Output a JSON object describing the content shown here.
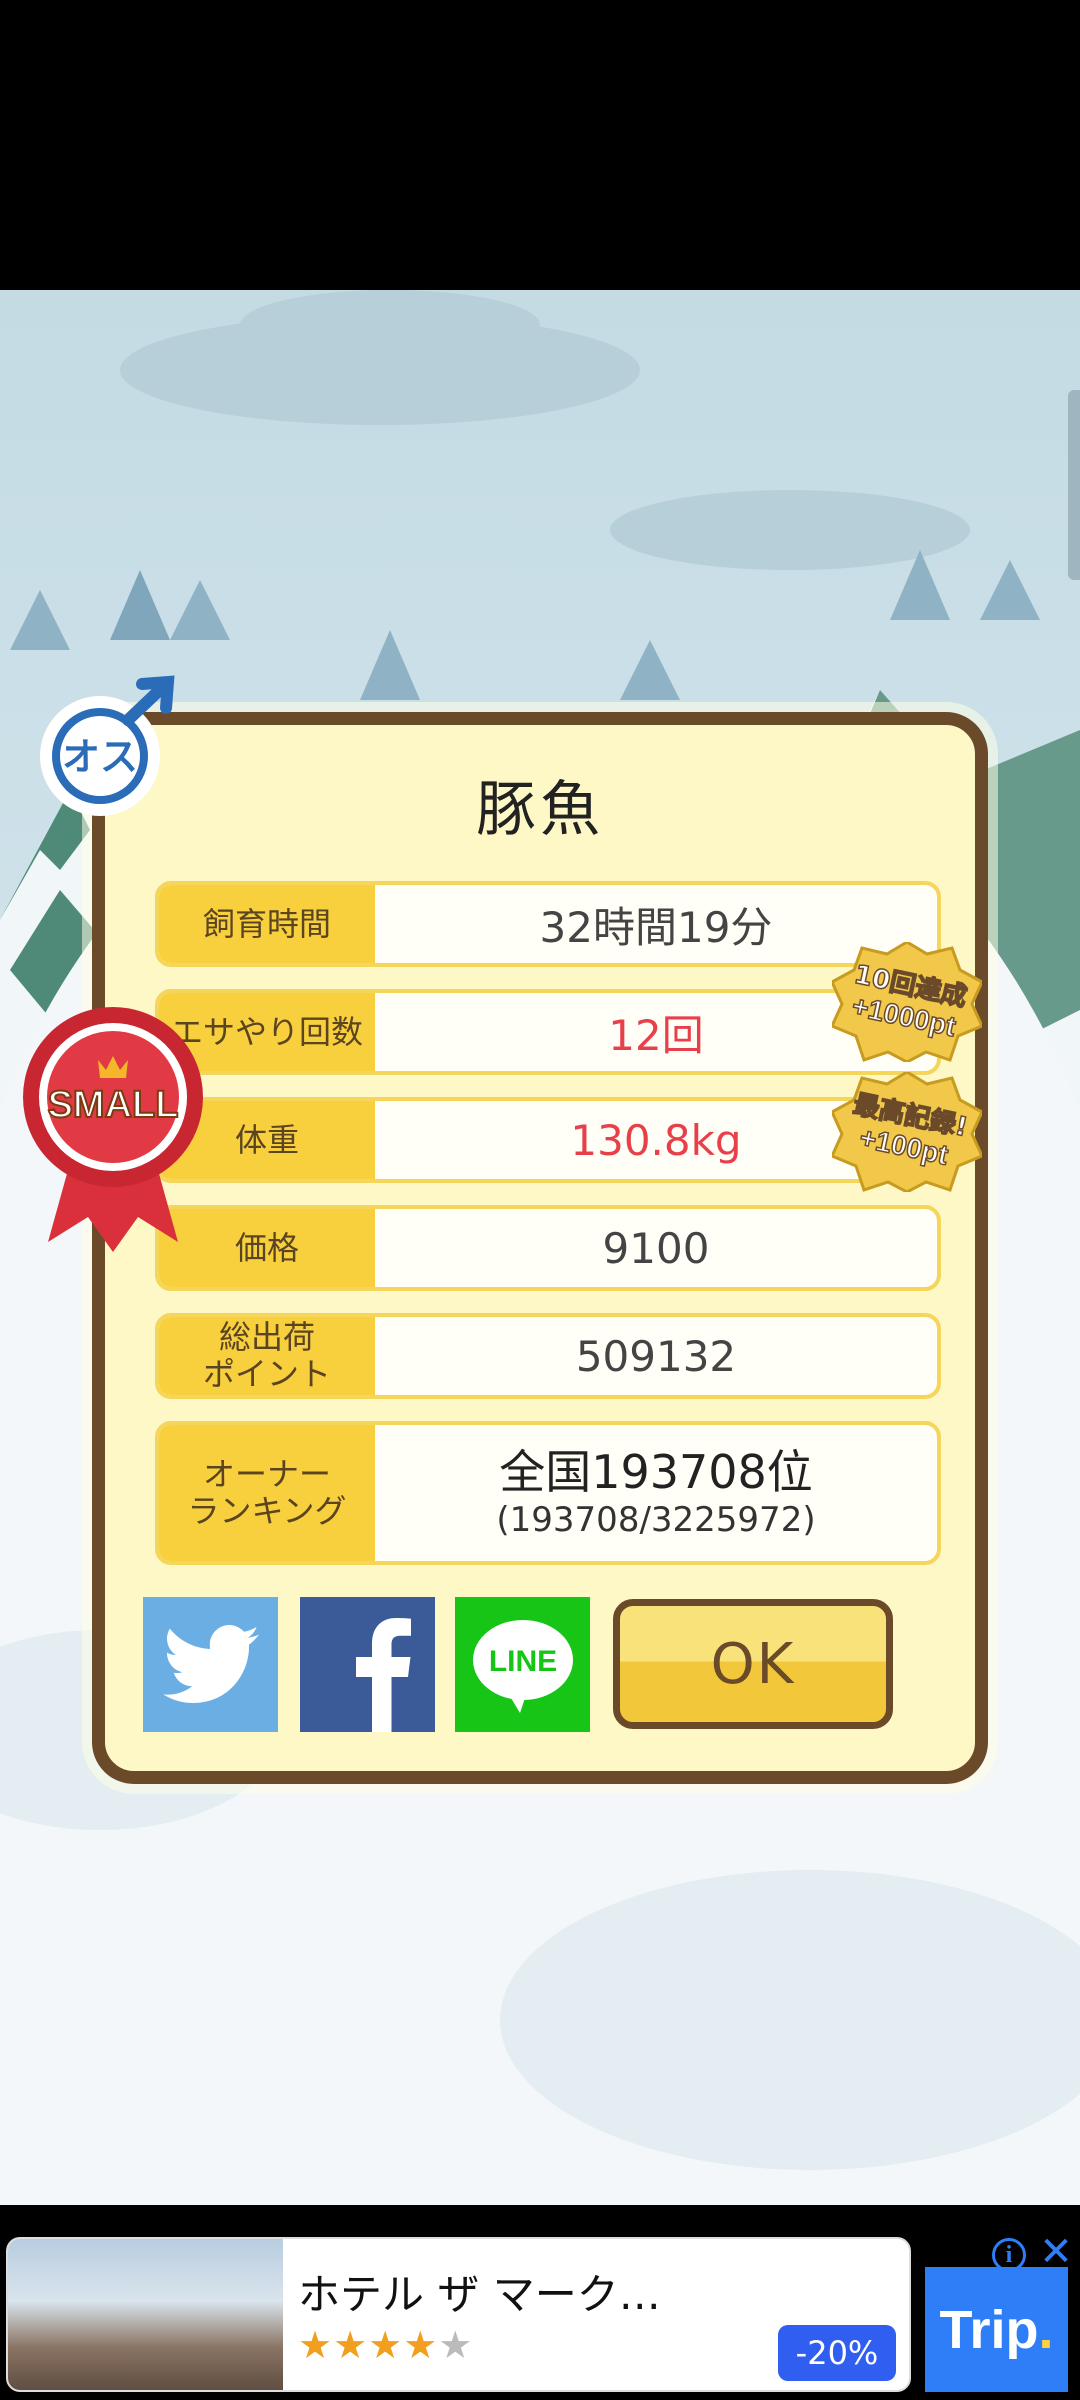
{
  "popup": {
    "title": "豚魚",
    "gender_label": "オス",
    "ribbon_label": "SMALL",
    "rows": [
      {
        "label": "飼育時間",
        "value": "32時間19分"
      },
      {
        "label": "エサやり回数",
        "value": "12回"
      },
      {
        "label": "体重",
        "value": "130.8kg"
      },
      {
        "label": "価格",
        "value": "9100"
      },
      {
        "label": "総出荷\nポイント",
        "value": "509132"
      },
      {
        "label": "オーナー\nランキング",
        "value": "全国193708位",
        "sub": "(193708/3225972)"
      }
    ],
    "ok_label": "OK",
    "share": {
      "line_label": "LINE"
    }
  },
  "badges": [
    {
      "line1": "10回達成",
      "line2": "+1000pt"
    },
    {
      "line1": "最高記録!",
      "line2": "+100pt"
    }
  ],
  "ad": {
    "title": "ホテル ザ マーク…",
    "stars": "★★★★",
    "stars_off": "★",
    "discount": "-20%",
    "logo": "Trip",
    "logo_dot": ".",
    "info": "i",
    "close": "✕"
  },
  "colors": {
    "accent_yellow": "#f8cf3c",
    "frame_brown": "#6b4a2a",
    "red_value": "#e8404a",
    "twitter": "#6aaee4",
    "facebook": "#3b5a98",
    "line": "#16c516"
  }
}
